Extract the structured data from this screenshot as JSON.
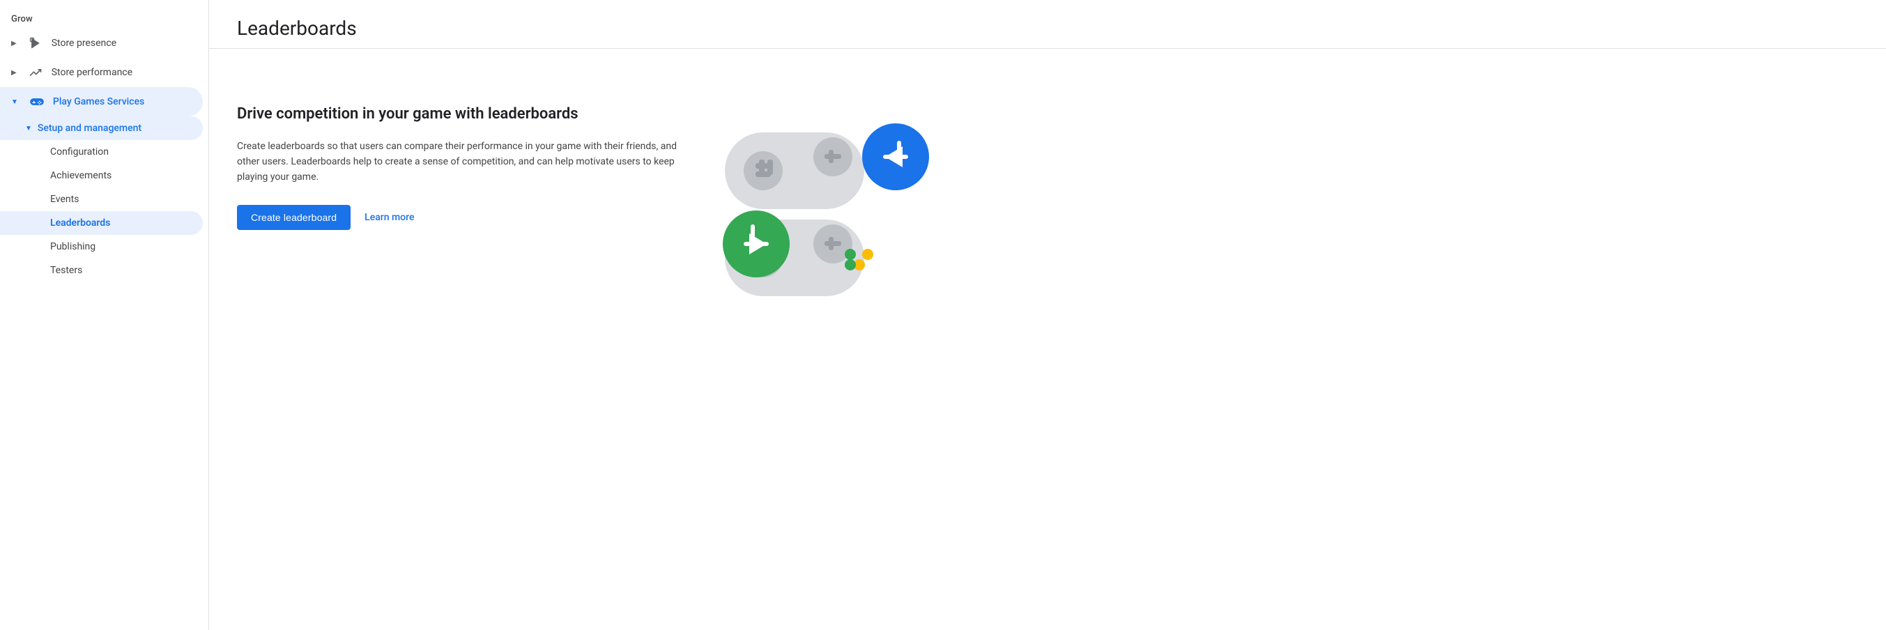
{
  "sidebar": {
    "grow_label": "Grow",
    "items": [
      {
        "id": "store-presence",
        "label": "Store presence",
        "icon": "play-icon",
        "has_chevron": true,
        "chevron_dir": "right",
        "active": false,
        "indent": 0
      },
      {
        "id": "store-performance",
        "label": "Store performance",
        "icon": "trending-icon",
        "has_chevron": true,
        "chevron_dir": "right",
        "active": false,
        "indent": 0
      },
      {
        "id": "play-games-services",
        "label": "Play Games Services",
        "icon": "gamepad-icon",
        "has_chevron": true,
        "chevron_dir": "down",
        "active": true,
        "indent": 0
      },
      {
        "id": "setup-management",
        "label": "Setup and management",
        "icon": null,
        "has_chevron": true,
        "chevron_dir": "down",
        "active": true,
        "indent": 1
      },
      {
        "id": "configuration",
        "label": "Configuration",
        "icon": null,
        "has_chevron": false,
        "active": false,
        "indent": 2
      },
      {
        "id": "achievements",
        "label": "Achievements",
        "icon": null,
        "has_chevron": false,
        "active": false,
        "indent": 2
      },
      {
        "id": "events",
        "label": "Events",
        "icon": null,
        "has_chevron": false,
        "active": false,
        "indent": 2
      },
      {
        "id": "leaderboards",
        "label": "Leaderboards",
        "icon": null,
        "has_chevron": false,
        "active": true,
        "indent": 2
      },
      {
        "id": "publishing",
        "label": "Publishing",
        "icon": null,
        "has_chevron": false,
        "active": false,
        "indent": 2
      },
      {
        "id": "testers",
        "label": "Testers",
        "icon": null,
        "has_chevron": false,
        "active": false,
        "indent": 2
      }
    ]
  },
  "main": {
    "page_title": "Leaderboards",
    "hero_heading": "Drive competition in your game with leaderboards",
    "hero_body": "Create leaderboards so that users can compare their performance in your game with their friends, and other users. Leaderboards help to create a sense of competition, and can help motivate users to keep playing your game.",
    "create_button_label": "Create leaderboard",
    "learn_more_label": "Learn more"
  },
  "colors": {
    "blue": "#1a73e8",
    "green": "#34a853",
    "yellow": "#fbbc04",
    "gray_light": "#dadce0",
    "gray_mid": "#bdc1c6",
    "gray_dark": "#9aa0a6",
    "active_bg": "#e8f0fe",
    "active_text": "#1a73e8"
  }
}
